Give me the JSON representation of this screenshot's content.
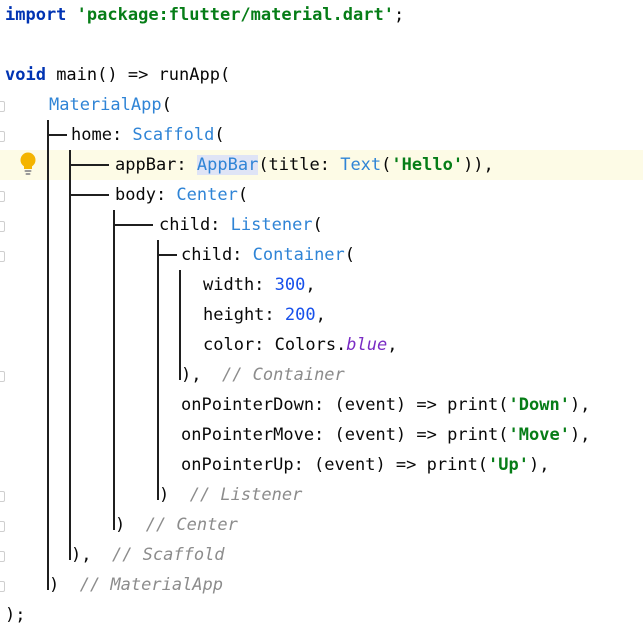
{
  "lines": [
    {
      "tokens": [
        {
          "t": "import",
          "c": "kw"
        },
        {
          "t": " "
        },
        {
          "t": "'package:flutter/material.dart'",
          "c": "str"
        },
        {
          "t": ";"
        }
      ]
    },
    {
      "tokens": []
    },
    {
      "tokens": [
        {
          "t": "void",
          "c": "kw"
        },
        {
          "t": " main() => runApp("
        }
      ]
    },
    {
      "tokens": [
        {
          "t": "MaterialApp",
          "c": "cls"
        },
        {
          "t": "("
        }
      ]
    },
    {
      "tokens": [
        {
          "t": "home: "
        },
        {
          "t": "Scaffold",
          "c": "cls"
        },
        {
          "t": "("
        }
      ]
    },
    {
      "tokens": [
        {
          "t": "appBar: "
        },
        {
          "t": "AppBar",
          "c": "cls ref"
        },
        {
          "t": "(title: "
        },
        {
          "t": "Text",
          "c": "cls"
        },
        {
          "t": "("
        },
        {
          "t": "'Hello'",
          "c": "str"
        },
        {
          "t": ")),"
        }
      ]
    },
    {
      "tokens": [
        {
          "t": "body: "
        },
        {
          "t": "Center",
          "c": "cls"
        },
        {
          "t": "("
        }
      ]
    },
    {
      "tokens": [
        {
          "t": "child: "
        },
        {
          "t": "Listener",
          "c": "cls"
        },
        {
          "t": "("
        }
      ]
    },
    {
      "tokens": [
        {
          "t": "child: "
        },
        {
          "t": "Container",
          "c": "cls"
        },
        {
          "t": "("
        }
      ]
    },
    {
      "tokens": [
        {
          "t": "width: "
        },
        {
          "t": "300",
          "c": "num"
        },
        {
          "t": ","
        }
      ]
    },
    {
      "tokens": [
        {
          "t": "height: "
        },
        {
          "t": "200",
          "c": "num"
        },
        {
          "t": ","
        }
      ]
    },
    {
      "tokens": [
        {
          "t": "color: Colors."
        },
        {
          "t": "blue",
          "c": "purple"
        },
        {
          "t": ","
        }
      ]
    },
    {
      "tokens": [
        {
          "t": "),  "
        },
        {
          "t": "// Container",
          "c": "cmt"
        }
      ]
    },
    {
      "tokens": [
        {
          "t": "onPointerDown: (event) => print("
        },
        {
          "t": "'Down'",
          "c": "str"
        },
        {
          "t": "),"
        }
      ]
    },
    {
      "tokens": [
        {
          "t": "onPointerMove: (event) => print("
        },
        {
          "t": "'Move'",
          "c": "str"
        },
        {
          "t": "),"
        }
      ]
    },
    {
      "tokens": [
        {
          "t": "onPointerUp: (event) => print("
        },
        {
          "t": "'Up'",
          "c": "str"
        },
        {
          "t": "),"
        }
      ]
    },
    {
      "tokens": [
        {
          "t": ")  "
        },
        {
          "t": "// Listener",
          "c": "cmt"
        }
      ]
    },
    {
      "tokens": [
        {
          "t": ")  "
        },
        {
          "t": "// Center",
          "c": "cmt"
        }
      ]
    },
    {
      "tokens": [
        {
          "t": "),  "
        },
        {
          "t": "// Scaffold",
          "c": "cmt"
        }
      ]
    },
    {
      "tokens": [
        {
          "t": ")  "
        },
        {
          "t": "// MaterialApp",
          "c": "cmt"
        }
      ]
    },
    {
      "tokens": [
        {
          "t": ");"
        }
      ]
    }
  ],
  "highlighted_line": 6,
  "intention_icon": "lightbulb-icon",
  "colors": {
    "keyword": "#0033b3",
    "string": "#067d17",
    "class": "#2f84d6",
    "number": "#1750eb",
    "comment": "#8c8c8c",
    "field": "#7a2cc4",
    "caret_row": "#fdfbe6",
    "guide": "#1f1f1f"
  }
}
